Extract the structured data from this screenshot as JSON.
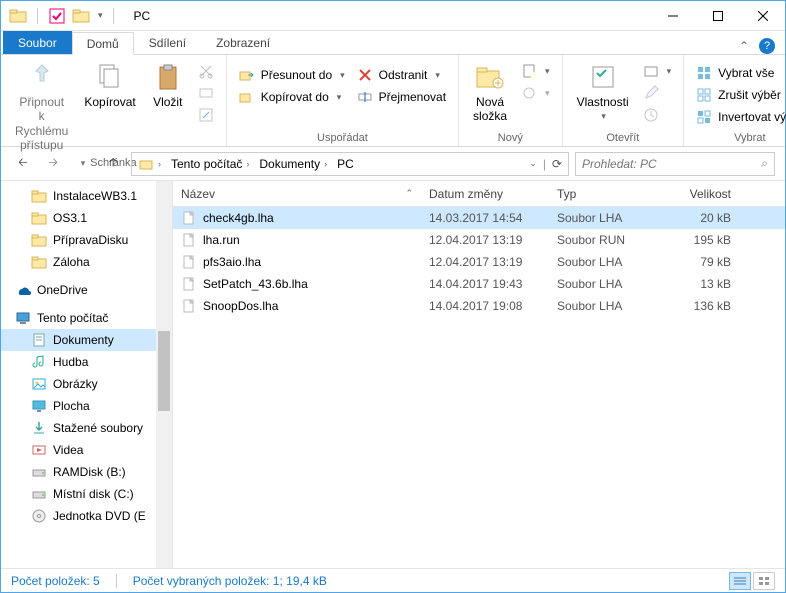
{
  "window": {
    "title": "PC"
  },
  "tabs": {
    "file": "Soubor",
    "home": "Domů",
    "share": "Sdílení",
    "view": "Zobrazení"
  },
  "ribbon": {
    "clipboard": {
      "label": "Schránka",
      "pin": "Připnout k\nRychlému přístupu",
      "copy": "Kopírovat",
      "paste": "Vložit"
    },
    "organize": {
      "label": "Uspořádat",
      "moveTo": "Přesunout do",
      "copyTo": "Kopírovat do",
      "delete": "Odstranit",
      "rename": "Přejmenovat"
    },
    "new": {
      "label": "Nový",
      "newFolder": "Nová\nsložka"
    },
    "open": {
      "label": "Otevřít",
      "properties": "Vlastnosti"
    },
    "select": {
      "label": "Vybrat",
      "selectAll": "Vybrat vše",
      "selectNone": "Zrušit výběr",
      "invert": "Invertovat výběr"
    }
  },
  "breadcrumb": {
    "items": [
      "Tento počítač",
      "Dokumenty",
      "PC"
    ]
  },
  "search": {
    "placeholder": "Prohledat: PC"
  },
  "tree": {
    "folders": [
      {
        "label": "InstalaceWB3.1",
        "level": 1,
        "icon": "folder"
      },
      {
        "label": "OS3.1",
        "level": 1,
        "icon": "folder"
      },
      {
        "label": "PřípravaDisku",
        "level": 1,
        "icon": "folder"
      },
      {
        "label": "Záloha",
        "level": 1,
        "icon": "folder"
      }
    ],
    "onedrive": "OneDrive",
    "thispc": "Tento počítač",
    "pcitems": [
      {
        "label": "Dokumenty",
        "icon": "documents",
        "selected": true
      },
      {
        "label": "Hudba",
        "icon": "music"
      },
      {
        "label": "Obrázky",
        "icon": "pictures"
      },
      {
        "label": "Plocha",
        "icon": "desktop"
      },
      {
        "label": "Stažené soubory",
        "icon": "downloads"
      },
      {
        "label": "Videa",
        "icon": "videos"
      },
      {
        "label": "RAMDisk (B:)",
        "icon": "drive"
      },
      {
        "label": "Místní disk (C:)",
        "icon": "drive"
      },
      {
        "label": "Jednotka DVD (E",
        "icon": "dvd"
      }
    ]
  },
  "columns": {
    "name": "Název",
    "date": "Datum změny",
    "type": "Typ",
    "size": "Velikost"
  },
  "files": [
    {
      "name": "check4gb.lha",
      "date": "14.03.2017 14:54",
      "type": "Soubor LHA",
      "size": "20 kB",
      "selected": true
    },
    {
      "name": "lha.run",
      "date": "12.04.2017 13:19",
      "type": "Soubor RUN",
      "size": "195 kB"
    },
    {
      "name": "pfs3aio.lha",
      "date": "12.04.2017 13:19",
      "type": "Soubor LHA",
      "size": "79 kB"
    },
    {
      "name": "SetPatch_43.6b.lha",
      "date": "14.04.2017 19:43",
      "type": "Soubor LHA",
      "size": "13 kB"
    },
    {
      "name": "SnoopDos.lha",
      "date": "14.04.2017 19:08",
      "type": "Soubor LHA",
      "size": "136 kB"
    }
  ],
  "status": {
    "count": "Počet položek: 5",
    "selected": "Počet vybraných položek: 1; 19,4 kB"
  }
}
